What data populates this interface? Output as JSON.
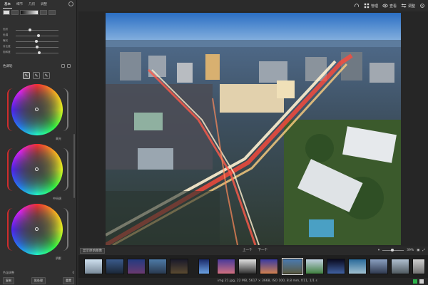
{
  "left_panel": {
    "tabs": [
      "基本",
      "细节",
      "几何",
      "调整"
    ],
    "slider_rows": [
      {
        "label": "色阶",
        "value": 0.3
      },
      {
        "label": "色调",
        "value": 0.5
      },
      {
        "label": "曝光",
        "value": 0.45
      },
      {
        "label": "对比度",
        "value": 0.48
      },
      {
        "label": "饱和度",
        "value": 0.52
      }
    ],
    "wheel_section_title": "色调轮",
    "wheels": [
      {
        "label": "高光"
      },
      {
        "label": "中间调"
      },
      {
        "label": "阴影"
      }
    ],
    "footer": {
      "row1_left": "色温调整",
      "row1_right": "0",
      "copy_button": "复制",
      "apply_button": "批处理",
      "reset_button": "重置"
    }
  },
  "topbar": {
    "items": [
      "管理",
      "查看",
      "调整"
    ]
  },
  "bottom_toolbar": {
    "left_button": "显示原始图像",
    "prev": "上一个",
    "next": "下一个",
    "zoom": "39%"
  },
  "status": {
    "text": "img 21.jpg, 22 MB, 5617 × 3668, ISO 100, 8.8 mm, f/11, 1/1 s"
  },
  "colors": {
    "accent_green": "#2db34a",
    "wheel_arc_red": "#cf2d2d"
  }
}
